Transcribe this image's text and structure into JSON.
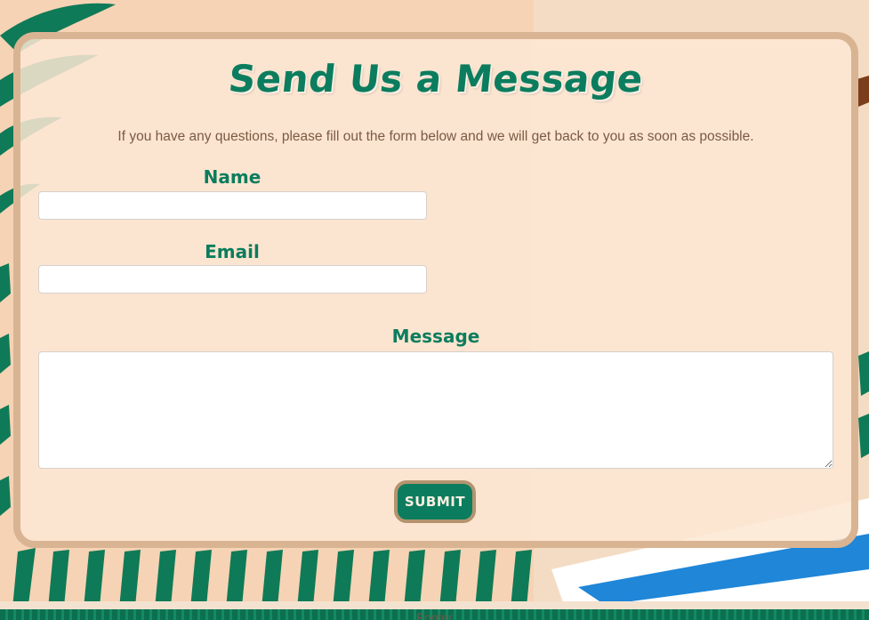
{
  "form": {
    "title": "Send Us a Message",
    "subtitle": "If you have any questions, please fill out the form below and we will get back to you as soon as possible.",
    "name_label": "Name",
    "name_value": "",
    "email_label": "Email",
    "email_value": "",
    "message_label": "Message",
    "message_value": "",
    "submit_label": "SUBMIT"
  },
  "footer": {
    "text": "Footer"
  },
  "colors": {
    "accent": "#0b7d5e",
    "card_border": "#d9b493",
    "card_background": "#fde8d4",
    "button_border": "#b4946f",
    "subtitle_text": "#7a5a44",
    "footer": "#0c6f4f"
  },
  "icons": {
    "background": "palm-leaves-illustration",
    "textarea_resize": "resize-handle-icon"
  }
}
